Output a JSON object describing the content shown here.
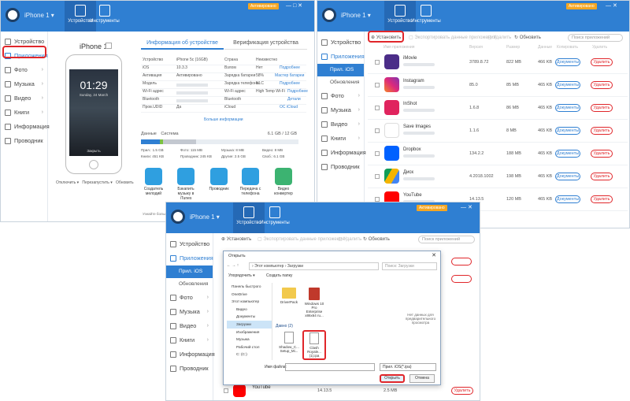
{
  "colors": {
    "accent": "#2f7fd2",
    "badge": "#f5a623",
    "highlight": "#e0262a"
  },
  "w1": {
    "device": "iPhone 1 ▾",
    "tabs": [
      "Устройство",
      "Инструменты"
    ],
    "badge": "Активировано",
    "sidebar": [
      "Устройство",
      "Приложения",
      "Фото",
      "Музыка",
      "Видео",
      "Книги",
      "Информация",
      "Проводник"
    ],
    "phone": {
      "name": "iPhone 1",
      "time": "01:29",
      "date": "Sunday, 24 March",
      "unlock": "Закрыть"
    },
    "phone_actions": [
      "Отключить",
      "Перезапустить",
      "Обновить"
    ],
    "info_tabs": [
      "Информация об устройстве",
      "Верификация устройства"
    ],
    "info": [
      [
        "Устройство",
        "iPhone 5c (16GB)",
        "Страна",
        "Неизвестно"
      ],
      [
        "iOS",
        "10.3.3",
        "Взлом",
        "Нет",
        "Подробнее"
      ],
      [
        "Активация",
        "Активировано",
        "Зарядка батареи",
        "58%",
        "Мастер батареи"
      ],
      [
        "Модель",
        "",
        "Зарядка телефона",
        "NLC",
        "Подробнее"
      ],
      [
        "Wi-Fi адрес",
        "",
        "Wi-Fi адрес",
        "High Temp Wi-Fi",
        "Подробнее"
      ],
      [
        "Bluetooth",
        "",
        "Bluetooth",
        "",
        "Детали"
      ],
      [
        "Пров.UDID",
        "Да",
        "iCloud",
        "",
        "ОС iCloud"
      ]
    ],
    "more_info": "Больше информации",
    "storage_label": "Данные",
    "storage_type": "Система",
    "storage_total": "6.1 GB / 12 GB",
    "legend": [
      "Прил.: 1.5 GB",
      "Фото: 115 MB",
      "Музыка: 8 MB",
      "Видео: 8 MB",
      "Книги: 451 KB",
      "Проводник: 245 KB",
      "Другие: 2.5 GB",
      "Своб.: 6.1 GB"
    ],
    "tools": [
      "Создатель мелодий",
      "Бэкапить музыку в iTunes",
      "Проводник",
      "Передача с телефона",
      "Видео конвертер"
    ],
    "ad": "Узнайте больше"
  },
  "w2": {
    "device": "iPhone 1 ▾",
    "tabs": [
      "Устройство",
      "Инструменты"
    ],
    "badge": "Активировано",
    "sidebar": [
      "Устройство",
      "Приложения",
      "Фото",
      "Музыка",
      "Видео",
      "Книги",
      "Информация",
      "Проводник"
    ],
    "subitems": [
      "Прил. iOS",
      "Обновления"
    ],
    "toolbar": [
      "Установить",
      "Экспортировать данные приложения",
      "Удалить",
      "Обновить"
    ],
    "search": "Поиск приложений",
    "columns": [
      "Имя приложения",
      "Версия",
      "Размер",
      "Данные",
      "Копировать",
      "Удалить"
    ],
    "apps": [
      {
        "name": "iMovie",
        "ver": "3789.8.72",
        "size": "822 MB",
        "data": "466 KB"
      },
      {
        "name": "Instagram",
        "ver": "85.0",
        "size": "85 MB",
        "data": "465 KB"
      },
      {
        "name": "InShot",
        "ver": "1.6.8",
        "size": "86 MB",
        "data": "465 KB"
      },
      {
        "name": "Save Images",
        "ver": "1.1.6",
        "size": "8 MB",
        "data": "465 KB"
      },
      {
        "name": "Dropbox",
        "ver": "134.2.2",
        "size": "188 MB",
        "data": "465 KB"
      },
      {
        "name": "Диск",
        "ver": "4.2018.1002",
        "size": "198 MB",
        "data": "465 KB"
      },
      {
        "name": "YouTube",
        "ver": "14.13.5",
        "size": "120 MB",
        "data": "465 KB"
      }
    ],
    "copy": "Документы",
    "del": "Удалить"
  },
  "w3": {
    "device": "iPhone 1 ▾",
    "tabs": [
      "Устройство",
      "Инструменты"
    ],
    "badge": "Активировано",
    "sidebar": [
      "Устройство",
      "Приложения",
      "Фото",
      "Музыка",
      "Видео",
      "Книги",
      "Информация",
      "Проводник"
    ],
    "subitems": [
      "Прил. iOS",
      "Обновления"
    ],
    "toolbar": [
      "Установить",
      "Экспортировать данные приложения",
      "Удалить",
      "Обновить"
    ],
    "search": "Поиск приложений",
    "bottom_app": {
      "name": "YouTube",
      "ver": "14.13.5",
      "size": "2.5 MB"
    },
    "del": "Удалить"
  },
  "dialog": {
    "title": "Открыть",
    "path": [
      "Этот компьютер",
      "Загрузки"
    ],
    "search": "Поиск: Загрузки",
    "organize": "Упорядочить ▾",
    "newfolder": "Создать папку",
    "tree": [
      "Панель быстрого",
      "OneDrive",
      "Этот компьютер",
      "Видео",
      "Документы",
      "Загрузки",
      "Изображения",
      "Музыка",
      "Рабочий стол",
      "C: (C:)"
    ],
    "group": "Давно (2)",
    "files": [
      "DriverPack",
      "Windows 10 Pro Enterprise x86x64 ru...",
      "Shadow_C... Setup_Mi...",
      "Clash Royale... (1).ipa"
    ],
    "preview": "Нет данных для предварительного просмотра",
    "filename_label": "Имя файла:",
    "filetype": "Прил. iOS(*.ipa)",
    "open": "Открыть",
    "cancel": "Отмена"
  }
}
